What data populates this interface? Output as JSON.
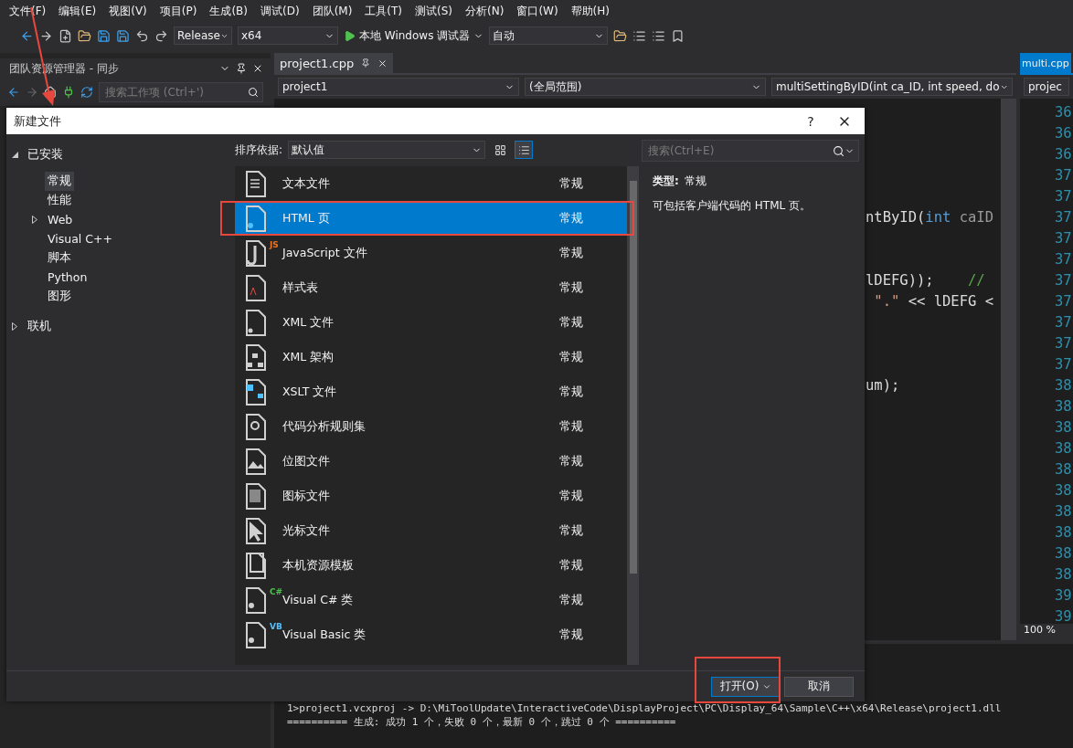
{
  "menu": [
    "文件(F)",
    "编辑(E)",
    "视图(V)",
    "项目(P)",
    "生成(B)",
    "调试(D)",
    "团队(M)",
    "工具(T)",
    "测试(S)",
    "分析(N)",
    "窗口(W)",
    "帮助(H)"
  ],
  "toolbar": {
    "config": "Release",
    "platform": "x64",
    "debugger": "本地 Windows 调试器",
    "mode": "自动"
  },
  "team_panel": {
    "title": "团队资源管理器 - 同步",
    "search": {
      "placeholder": "搜索工作项 (Ctrl+')"
    }
  },
  "editor": {
    "tabs": [
      {
        "label": "project1.cpp",
        "selected": true
      }
    ],
    "nav": [
      "project1",
      "(全局范围)",
      "multiSettingByID(int ca_ID, int speed, do"
    ],
    "code_lines": [
      {
        "kind": "blank"
      },
      {
        "kind": "blank"
      },
      {
        "kind": "blank"
      },
      {
        "kind": "blank"
      },
      {
        "kind": "blank"
      },
      {
        "kind": "code",
        "parts": [
          {
            "text": "ntByID(",
            "kind": "plain"
          },
          {
            "text": "int",
            "kind": "keyword"
          },
          {
            "text": " caID",
            "kind": "param"
          }
        ]
      },
      {
        "kind": "blank"
      },
      {
        "kind": "blank"
      },
      {
        "kind": "code",
        "parts": [
          {
            "text": "lDEFG));",
            "kind": "plain"
          },
          {
            "text": "    //",
            "kind": "comment"
          }
        ]
      },
      {
        "kind": "code",
        "parts": [
          {
            "text": " \".\"",
            "kind": "string"
          },
          {
            "text": " << lDEFG <",
            "kind": "plain"
          }
        ]
      },
      {
        "kind": "blank"
      },
      {
        "kind": "blank"
      },
      {
        "kind": "blank"
      },
      {
        "kind": "code",
        "parts": [
          {
            "text": "um);",
            "kind": "plain"
          }
        ]
      }
    ]
  },
  "split_pane": {
    "tab": "multi.cpp",
    "nav": "projec",
    "line_numbers": [
      "36",
      "36",
      "36",
      "37",
      "37",
      "37",
      "37",
      "37",
      "37",
      "37",
      "37",
      "37",
      "37",
      "38",
      "38",
      "38",
      "38",
      "38",
      "38",
      "38",
      "38",
      "38",
      "38",
      "39",
      "39"
    ],
    "zoom": "100 %"
  },
  "output": {
    "lines": [
      "1>project1.vcxproj -> D:\\MiToolUpdate\\InteractiveCode\\DisplayProject\\PC\\Display_64\\Sample\\C++\\x64\\Release\\project1.dll",
      "========== 生成: 成功 1 个，失败 0 个，最新 0 个，跳过 0 个 =========="
    ]
  },
  "dialog": {
    "title": "新建文件",
    "help": "?",
    "tree": [
      {
        "label": "已安装",
        "expanded": true,
        "children": [
          {
            "label": "常规",
            "selected": true
          },
          {
            "label": "性能",
            "selected": false
          },
          {
            "label": "Web",
            "selected": false,
            "expanded": false
          },
          {
            "label": "Visual C++",
            "selected": false
          },
          {
            "label": "脚本",
            "selected": false
          },
          {
            "label": "Python",
            "selected": false
          },
          {
            "label": "图形",
            "selected": false
          }
        ]
      },
      {
        "label": "联机",
        "expanded": false
      }
    ],
    "sort": {
      "label": "排序依据:",
      "value": "默认值"
    },
    "views": [
      {
        "kind": "grid",
        "selected": false
      },
      {
        "kind": "list",
        "selected": true
      }
    ],
    "search": {
      "placeholder": "搜索(Ctrl+E)"
    },
    "templates": [
      {
        "name": "文本文件",
        "category": "常规",
        "selected": false,
        "kind": "text"
      },
      {
        "name": "HTML 页",
        "category": "常规",
        "selected": true,
        "highlighted": true,
        "kind": "html"
      },
      {
        "name": "JavaScript 文件",
        "category": "常规",
        "selected": false,
        "kind": "script",
        "badge": "JS",
        "color": "#f0701e"
      },
      {
        "name": "样式表",
        "category": "常规",
        "selected": false,
        "kind": "style"
      },
      {
        "name": "XML 文件",
        "category": "常规",
        "selected": false,
        "kind": "xml"
      },
      {
        "name": "XML 架构",
        "category": "常规",
        "selected": false,
        "kind": "schema"
      },
      {
        "name": "XSLT 文件",
        "category": "常规",
        "selected": false,
        "kind": "xslt"
      },
      {
        "name": "代码分析规则集",
        "category": "常规",
        "selected": false,
        "kind": "rules"
      },
      {
        "name": "位图文件",
        "category": "常规",
        "selected": false,
        "kind": "image"
      },
      {
        "name": "图标文件",
        "category": "常规",
        "selected": false,
        "kind": "iconfile"
      },
      {
        "name": "光标文件",
        "category": "常规",
        "selected": false,
        "kind": "cursor"
      },
      {
        "name": "本机资源模板",
        "category": "常规",
        "selected": false,
        "kind": "resource"
      },
      {
        "name": "Visual C# 类",
        "category": "常规",
        "selected": false,
        "kind": "class",
        "badge": "C#",
        "color": "#4fc14f"
      },
      {
        "name": "Visual Basic 类",
        "category": "常规",
        "selected": false,
        "kind": "class",
        "badge": "VB",
        "color": "#4fc1ff"
      }
    ],
    "details": {
      "type_label": "类型:",
      "type_value": "常规",
      "description": "可包括客户端代码的 HTML 页。"
    },
    "buttons": [
      {
        "label": "打开(O)",
        "kind": "split",
        "highlighted": true
      },
      {
        "label": "取消",
        "kind": "plain",
        "highlighted": false
      }
    ]
  },
  "annotations": [
    {
      "kind": "arrow"
    }
  ]
}
